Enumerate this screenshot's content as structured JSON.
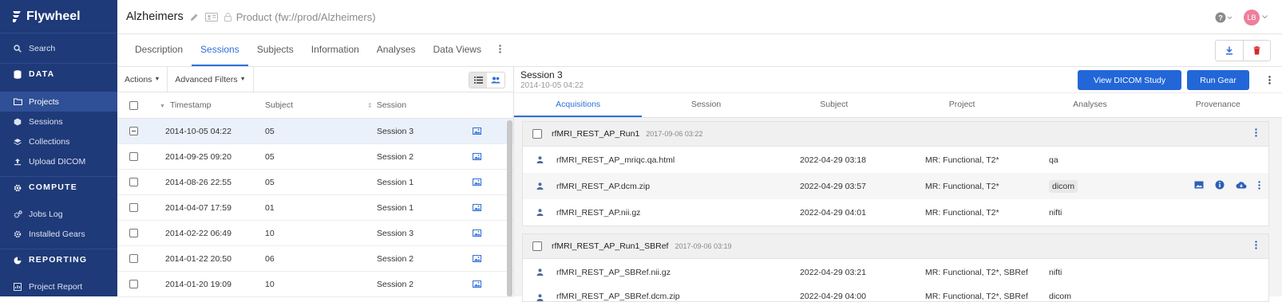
{
  "sidebar": {
    "brand": "Flywheel",
    "search": "Search",
    "sections": {
      "data": "DATA",
      "compute": "COMPUTE",
      "reporting": "REPORTING"
    },
    "data_items": [
      {
        "label": "Projects",
        "icon": "folder-icon",
        "active": true
      },
      {
        "label": "Sessions",
        "icon": "cube-icon"
      },
      {
        "label": "Collections",
        "icon": "layers-icon"
      },
      {
        "label": "Upload DICOM",
        "icon": "upload-icon"
      }
    ],
    "compute_items": [
      {
        "label": "Jobs Log",
        "icon": "gears-icon"
      },
      {
        "label": "Installed Gears",
        "icon": "gear-icon"
      }
    ],
    "reporting_items": [
      {
        "label": "Project Report",
        "icon": "report-icon"
      }
    ]
  },
  "header": {
    "project_title": "Alzheimers",
    "product_label": "Product (fw://prod/Alzheimers)",
    "avatar_initials": "LB"
  },
  "tabs": [
    "Description",
    "Sessions",
    "Subjects",
    "Information",
    "Analyses",
    "Data Views"
  ],
  "toolbar": {
    "actions": "Actions",
    "advanced_filters": "Advanced Filters"
  },
  "table": {
    "headers": {
      "timestamp": "Timestamp",
      "subject": "Subject",
      "session": "Session"
    },
    "rows": [
      {
        "timestamp": "2014-10-05 04:22",
        "subject": "05",
        "session": "Session 3"
      },
      {
        "timestamp": "2014-09-25 09:20",
        "subject": "05",
        "session": "Session 2"
      },
      {
        "timestamp": "2014-08-26 22:55",
        "subject": "05",
        "session": "Session 1"
      },
      {
        "timestamp": "2014-04-07 17:59",
        "subject": "01",
        "session": "Session 1"
      },
      {
        "timestamp": "2014-02-22 06:49",
        "subject": "10",
        "session": "Session 3"
      },
      {
        "timestamp": "2014-01-22 20:50",
        "subject": "06",
        "session": "Session 2"
      },
      {
        "timestamp": "2014-01-20 19:09",
        "subject": "10",
        "session": "Session 2"
      }
    ]
  },
  "detail": {
    "session_title": "Session 3",
    "session_date": "2014-10-05 04:22",
    "view_dicom_label": "View DICOM Study",
    "run_gear_label": "Run Gear",
    "tabs": [
      "Acquisitions",
      "Session",
      "Subject",
      "Project",
      "Analyses",
      "Provenance"
    ],
    "acquisitions": [
      {
        "name": "rfMRI_REST_AP_Run1",
        "date": "2017-09-06 03:22",
        "files": [
          {
            "name": "rfMRI_REST_AP_mriqc.qa.html",
            "date": "2022-04-29 03:18",
            "classification": "MR: Functional, T2*",
            "type": "qa"
          },
          {
            "name": "rfMRI_REST_AP.dcm.zip",
            "date": "2022-04-29 03:57",
            "classification": "MR: Functional, T2*",
            "type": "dicom"
          },
          {
            "name": "rfMRI_REST_AP.nii.gz",
            "date": "2022-04-29 04:01",
            "classification": "MR: Functional, T2*",
            "type": "nifti"
          }
        ]
      },
      {
        "name": "rfMRI_REST_AP_Run1_SBRef",
        "date": "2017-09-06 03:19",
        "files": [
          {
            "name": "rfMRI_REST_AP_SBRef.nii.gz",
            "date": "2022-04-29 03:21",
            "classification": "MR: Functional, T2*, SBRef",
            "type": "nifti"
          },
          {
            "name": "rfMRI_REST_AP_SBRef.dcm.zip",
            "date": "2022-04-29 04:00",
            "classification": "MR: Functional, T2*, SBRef",
            "type": "dicom"
          }
        ]
      }
    ]
  },
  "colors": {
    "sidebar": "#1f3a78",
    "accent": "#2266d8",
    "avatar": "#ee7f9c"
  }
}
